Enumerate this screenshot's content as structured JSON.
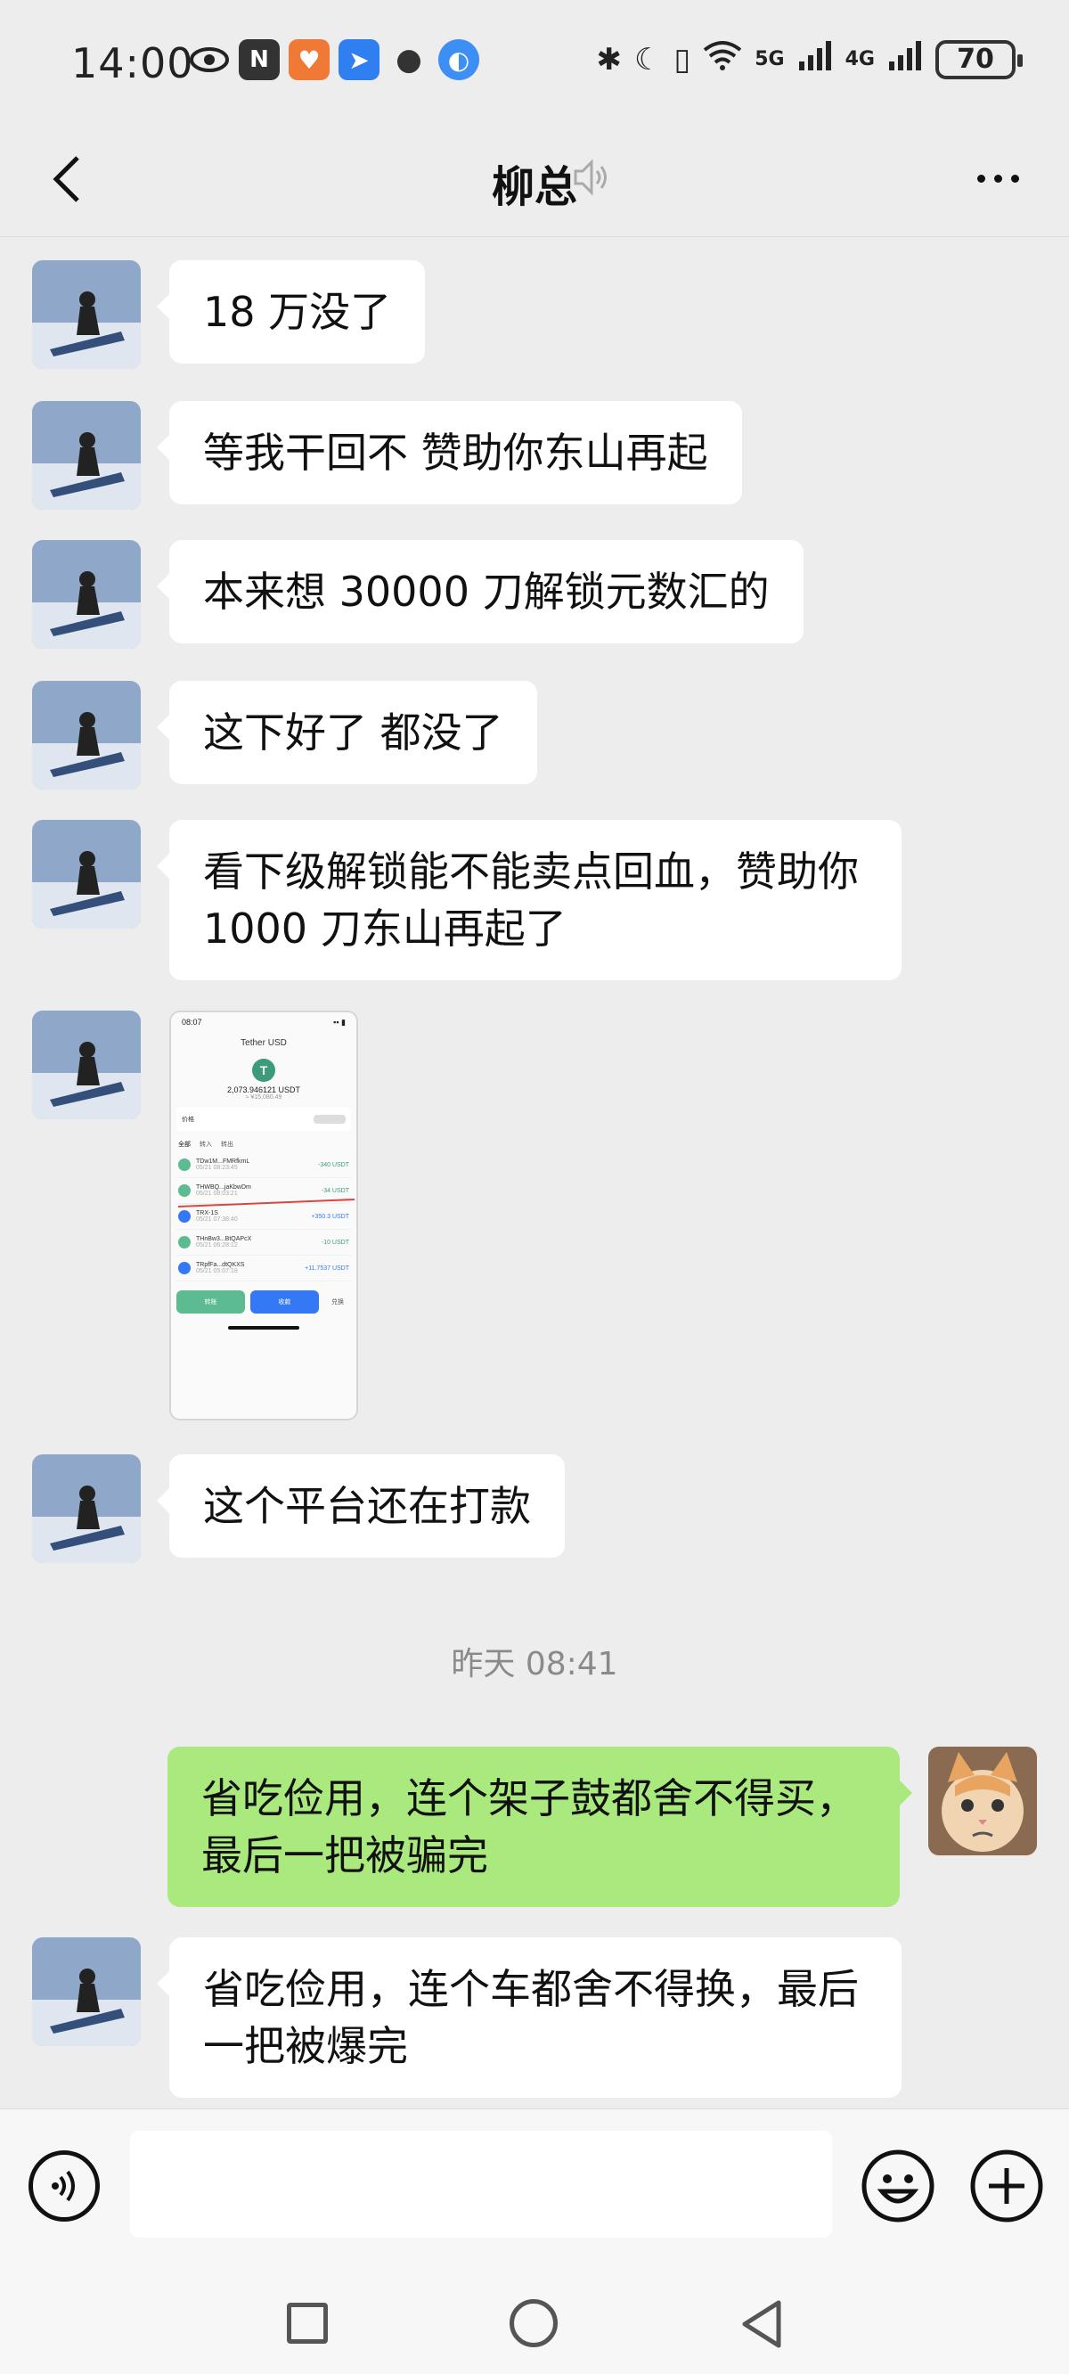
{
  "status_bar": {
    "time": "14:00",
    "signal_5g": "5G",
    "signal_4g": "4G",
    "battery": "70"
  },
  "header": {
    "title": "柳总"
  },
  "messages": [
    {
      "side": "left",
      "text": "18 万没了"
    },
    {
      "side": "left",
      "text": "等我干回不 赞助你东山再起"
    },
    {
      "side": "left",
      "text": "本来想 30000 刀解锁元数汇的"
    },
    {
      "side": "left",
      "text": "这下好了 都没了"
    },
    {
      "side": "left",
      "text": "看下级解锁能不能卖点回血，赞助你 1000 刀东山再起了"
    },
    {
      "side": "left",
      "text": "这个平台还在打款"
    },
    {
      "side": "right",
      "text": "省吃俭用，连个架子鼓都舍不得买，最后一把被骗完"
    },
    {
      "side": "left",
      "text": "省吃俭用，连个车都舍不得换，最后一把被爆完"
    }
  ],
  "timestamp": "昨天 08:41",
  "image_message": {
    "time": "08:07",
    "title": "Tether USD",
    "coin_symbol": "T",
    "amount": "2,073.946121 USDT",
    "amount_fiat": "≈ ¥15,080.49",
    "price_label": "价格",
    "tabs": [
      "全部",
      "转入",
      "转出"
    ],
    "transactions": [
      {
        "addr": "TDw1M...FMRfkmL",
        "date": "05/21 08:23:45",
        "amt": "-340 USDT",
        "color": "#3d9a7b"
      },
      {
        "addr": "THWBQ...jaKbwDm",
        "date": "05/21 08:03:21",
        "amt": "-34 USDT",
        "color": "#3d9a7b"
      },
      {
        "addr": "TRX-1S",
        "date": "05/21 07:38:40",
        "amt": "+350.3 USDT",
        "color": "#3478f6"
      },
      {
        "addr": "THnBw3...BtQAPcX",
        "date": "05/21 06:28:12",
        "amt": "-10 USDT",
        "color": "#3d9a7b"
      },
      {
        "addr": "TRpfFa...dtQKXS",
        "date": "05/21 05:07:18",
        "amt": "+11.7537 USDT",
        "color": "#3478f6"
      }
    ],
    "btn_transfer": "转账",
    "btn_receive": "收款",
    "btn_swap": "兑换"
  },
  "colors": {
    "background": "#ededed",
    "bubble_self": "#a9e97d",
    "bubble_other": "#ffffff"
  }
}
